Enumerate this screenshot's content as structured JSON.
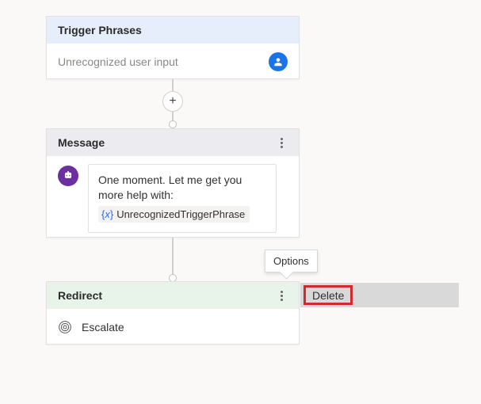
{
  "trigger": {
    "title": "Trigger Phrases",
    "placeholder": "Unrecognized user input"
  },
  "message": {
    "title": "Message",
    "text": "One moment. Let me get you more help with:",
    "variable": "UnrecognizedTriggerPhrase"
  },
  "redirect": {
    "title": "Redirect",
    "target": "Escalate"
  },
  "tooltip": "Options",
  "context_menu": {
    "delete": "Delete"
  }
}
